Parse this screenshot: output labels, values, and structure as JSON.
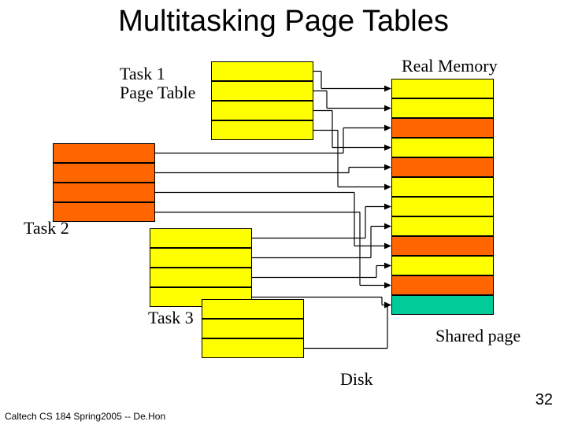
{
  "title": "Multitasking Page Tables",
  "labels": {
    "task1": "Task 1\nPage Table",
    "task2": "Task 2",
    "task3": "Task 3",
    "real_memory": "Real Memory",
    "shared_page": "Shared page",
    "disk": "Disk"
  },
  "footer": "Caltech CS 184 Spring2005 -- De.Hon",
  "slide_number": "32",
  "tables": {
    "task1": {
      "rows": 4,
      "color": "yellow"
    },
    "task2_upper": {
      "rows": 4,
      "color": "orange"
    },
    "task2_lower": {
      "rows": 4,
      "color": "yellow"
    },
    "task3_offset": {
      "rows": 3,
      "color": "yellow"
    },
    "real_memory": {
      "rows": 12,
      "row_colors": [
        "yellow",
        "yellow",
        "orange",
        "yellow",
        "orange",
        "yellow",
        "yellow",
        "yellow",
        "orange",
        "yellow",
        "orange",
        "teal"
      ]
    }
  },
  "chart_data": {
    "type": "diagram",
    "description": "Three task page tables mapping entries into a single real memory column; one teal frame is a shared page; 'Disk' label below.",
    "mappings": [
      {
        "from": "task1.row0",
        "to": "real_memory.row0"
      },
      {
        "from": "task1.row1",
        "to": "real_memory.row1"
      },
      {
        "from": "task1.row2",
        "to": "real_memory.row3"
      },
      {
        "from": "task1.row3",
        "to": "real_memory.row5"
      },
      {
        "from": "task2_upper.row0",
        "to": "real_memory.row2"
      },
      {
        "from": "task2_upper.row1",
        "to": "real_memory.row4"
      },
      {
        "from": "task2_upper.row2",
        "to": "real_memory.row8"
      },
      {
        "from": "task2_upper.row3",
        "to": "real_memory.row10"
      },
      {
        "from": "task2_lower.row0",
        "to": "real_memory.row6"
      },
      {
        "from": "task2_lower.row1",
        "to": "real_memory.row7"
      },
      {
        "from": "task2_lower.row2",
        "to": "real_memory.row9"
      },
      {
        "from": "task2_lower.row3",
        "to": "real_memory.row11"
      },
      {
        "from": "task3_offset.row2",
        "to": "real_memory.row11"
      }
    ]
  }
}
